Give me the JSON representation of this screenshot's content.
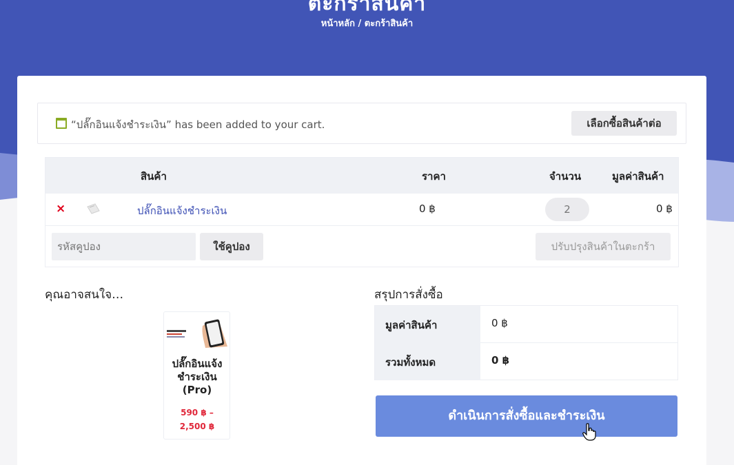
{
  "hero": {
    "title": "ตะกร้าสินค้า",
    "breadcrumb_home": "หน้าหลัก",
    "breadcrumb_sep": " / ",
    "breadcrumb_current": "ตะกร้าสินค้า"
  },
  "notice": {
    "message": "“ปลั๊กอินแจ้งชำระเงิน” has been added to your cart.",
    "continue_label": "เลือกซื้อสินค้าต่อ"
  },
  "cart": {
    "headers": {
      "product": "สินค้า",
      "price": "ราคา",
      "quantity": "จำนวน",
      "subtotal": "มูลค่าสินค้า"
    },
    "items": [
      {
        "remove": "×",
        "name": "ปลั๊กอินแจ้งชำระเงิน",
        "price": "0 ฿",
        "quantity": "2",
        "subtotal": "0 ฿"
      }
    ],
    "coupon_placeholder": "รหัสคูปอง",
    "apply_coupon_label": "ใช้คูปอง",
    "update_cart_label": "ปรับปรุงสินค้าในตะกร้า"
  },
  "cross_sells": {
    "title": "คุณอาจสนใจ…",
    "products": [
      {
        "name": "ปลั๊กอินแจ้งชำระเงิน (Pro)",
        "price": "590 ฿ – 2,500 ฿"
      }
    ]
  },
  "totals": {
    "title": "สรุปการสั่งซื้อ",
    "subtotal_label": "มูลค่าสินค้า",
    "subtotal_value": "0 ฿",
    "total_label": "รวมทั้งหมด",
    "total_value": "0 ฿",
    "checkout_label": "ดำเนินการสั่งซื้อและชำระเงิน"
  },
  "colors": {
    "hero": "#4155b6",
    "accent": "#3f51b5",
    "checkout": "#6a8bde",
    "remove": "#e0001a",
    "sale_price": "#e0273a"
  }
}
